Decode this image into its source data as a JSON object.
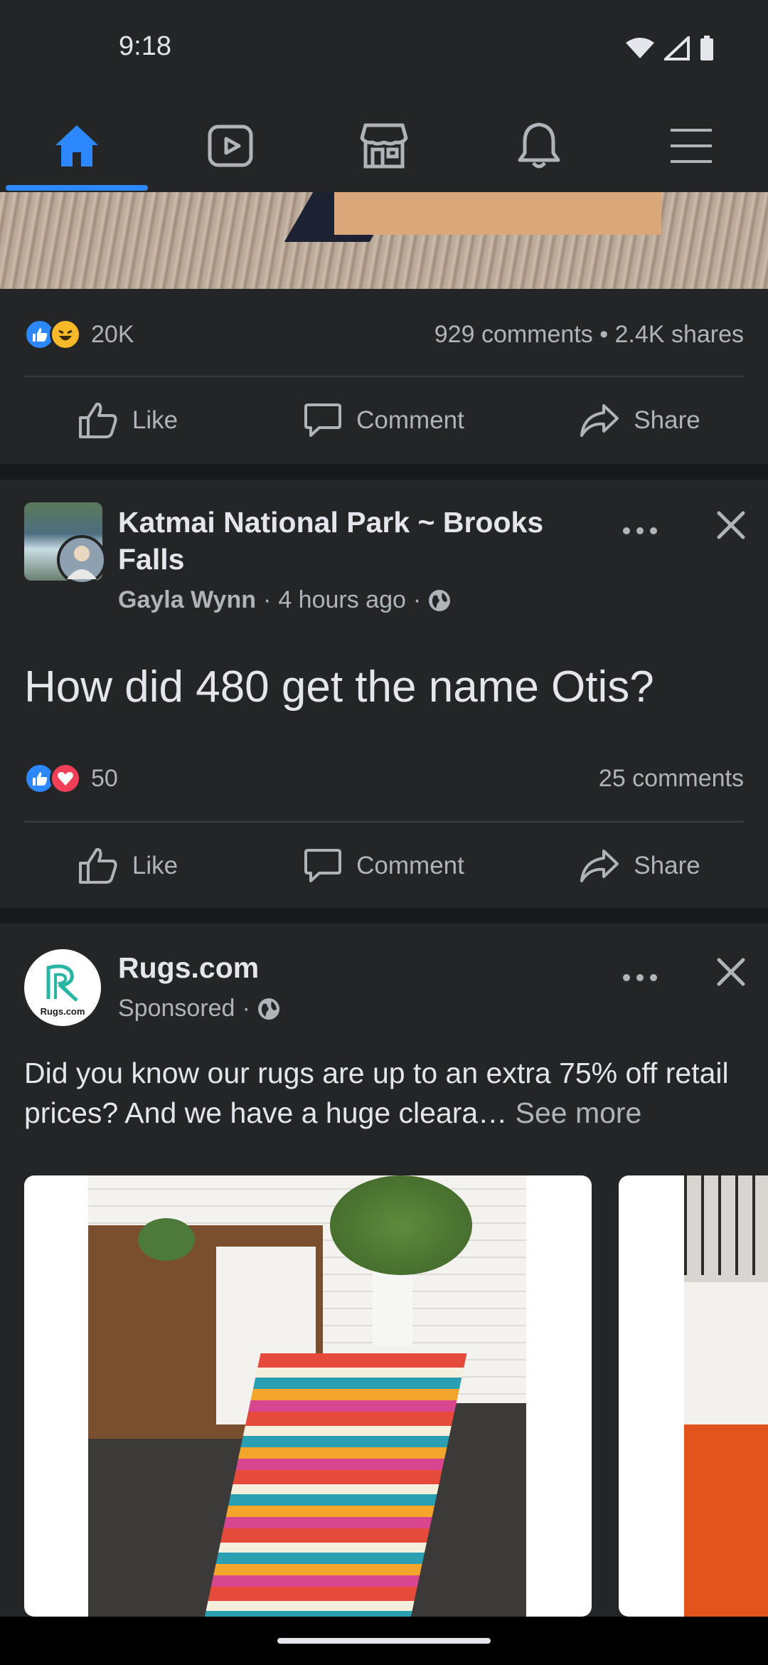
{
  "status_bar": {
    "time": "9:18"
  },
  "nav": {
    "tabs": [
      {
        "icon": "home-icon",
        "active": true
      },
      {
        "icon": "watch-icon",
        "active": false
      },
      {
        "icon": "marketplace-icon",
        "active": false
      },
      {
        "icon": "notifications-icon",
        "active": false
      },
      {
        "icon": "menu-icon",
        "active": false
      }
    ],
    "accent": "#2d88ff"
  },
  "post1": {
    "reactions_count": "20K",
    "comments_shares": "929 comments • 2.4K shares",
    "actions": {
      "like": "Like",
      "comment": "Comment",
      "share": "Share"
    }
  },
  "post2": {
    "group": "Katmai National Park ~ Brooks Falls",
    "author": "Gayla Wynn",
    "time": "4 hours ago",
    "body": "How did 480 get the name Otis?",
    "reactions_count": "50",
    "comments": "25 comments",
    "actions": {
      "like": "Like",
      "comment": "Comment",
      "share": "Share"
    }
  },
  "ad": {
    "name": "Rugs.com",
    "logo_text": "Rugs.com",
    "sponsored": "Sponsored",
    "text": "Did you know our rugs are up to an extra 75% off retail prices? And we have a huge cleara…",
    "see_more": "See more"
  }
}
